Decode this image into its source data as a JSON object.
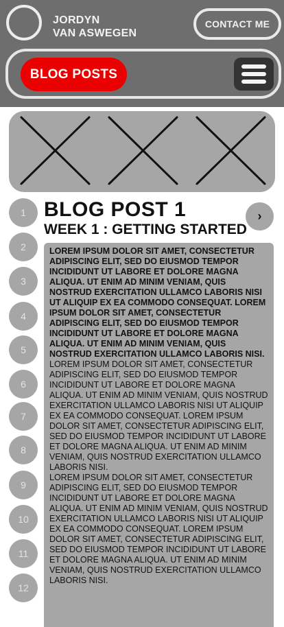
{
  "header": {
    "first_name": "JORDYN",
    "last_name": "VAN ASWEGEN",
    "contact_label": "CONTACT ME",
    "avatar_icon": "profile-circle-icon"
  },
  "nav": {
    "active_label": "BLOG POSTS",
    "active_color": "#ea0000",
    "menu_icon": "hamburger-menu-icon"
  },
  "hero": {
    "placeholders": [
      "image-placeholder",
      "image-placeholder",
      "image-placeholder"
    ]
  },
  "post_index": [
    "1",
    "2",
    "3",
    "4",
    "5",
    "6",
    "7",
    "8",
    "9",
    "10",
    "11",
    "12"
  ],
  "post": {
    "title": "BLOG POST 1",
    "subtitle": "WEEK 1 : GETTING STARTED",
    "next_label": "›",
    "intro": "LOREM IPSUM DOLOR SIT AMET, CONSECTETUR ADIPISCING ELIT, SED DO EIUSMOD TEMPOR INCIDIDUNT UT LABORE ET DOLORE MAGNA ALIQUA. UT ENIM AD MINIM VENIAM, QUIS NOSTRUD EXERCITATION ULLAMCO LABORIS NISI UT ALIQUIP EX EA COMMODO CONSEQUAT. LOREM IPSUM DOLOR SIT AMET, CONSECTETUR ADIPISCING ELIT, SED DO EIUSMOD TEMPOR INCIDIDUNT UT LABORE ET DOLORE MAGNA ALIQUA. UT ENIM AD MINIM VENIAM, QUIS NOSTRUD EXERCITATION ULLAMCO LABORIS NISI.",
    "paragraph_1": "LOREM IPSUM DOLOR SIT AMET, CONSECTETUR ADIPISCING ELIT, SED DO EIUSMOD TEMPOR INCIDIDUNT UT LABORE ET DOLORE MAGNA ALIQUA. UT ENIM AD MINIM VENIAM, QUIS NOSTRUD EXERCITATION ULLAMCO LABORIS NISI UT ALIQUIP EX EA COMMODO CONSEQUAT. LOREM IPSUM DOLOR SIT AMET, CONSECTETUR ADIPISCING ELIT, SED DO EIUSMOD TEMPOR INCIDIDUNT UT LABORE ET DOLORE MAGNA ALIQUA. UT ENIM AD MINIM VENIAM, QUIS NOSTRUD EXERCITATION ULLAMCO LABORIS NISI.",
    "paragraph_2": "LOREM IPSUM DOLOR SIT AMET, CONSECTETUR ADIPISCING ELIT, SED DO EIUSMOD TEMPOR INCIDIDUNT UT LABORE ET DOLORE MAGNA ALIQUA. UT ENIM AD MINIM VENIAM, QUIS NOSTRUD EXERCITATION ULLAMCO LABORIS NISI UT ALIQUIP EX EA COMMODO CONSEQUAT. LOREM IPSUM DOLOR SIT AMET, CONSECTETUR ADIPISCING ELIT, SED DO EIUSMOD TEMPOR INCIDIDUNT UT LABORE ET DOLORE MAGNA ALIQUA. UT ENIM AD MINIM VENIAM, QUIS NOSTRUD EXERCITATION ULLAMCO LABORIS NISI."
  }
}
